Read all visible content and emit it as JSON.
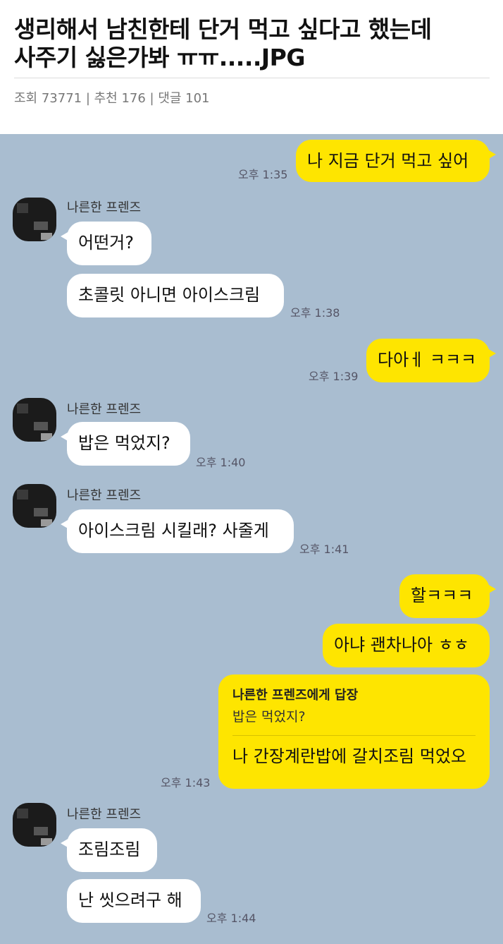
{
  "post": {
    "title_line1": "생리해서 남친한테 단거 먹고 싶다고 했는데",
    "title_line2": "사주기 싫은가봐 ㅠㅠ.....JPG",
    "meta": "조회 73771 | 추천 176 | 댓글 101"
  },
  "chat": {
    "sender_name": "나른한 프렌즈",
    "messages": [
      {
        "text": "나 지금 단거 먹고 싶어",
        "time": "오후 1:35"
      },
      {
        "text": "어떤거?"
      },
      {
        "text": "초콜릿 아니면 아이스크림",
        "time": "오후 1:38"
      },
      {
        "text": "다아ㅔ ㅋㅋㅋ",
        "time": "오후 1:39"
      },
      {
        "text": "밥은 먹었지?",
        "time": "오후 1:40"
      },
      {
        "text": "아이스크림 시킬래? 사줄게",
        "time": "오후 1:41"
      },
      {
        "text": "할ㅋㅋㅋ"
      },
      {
        "text": "아냐 괜차나아 ㅎㅎ"
      },
      {
        "reply_header": "나른한 프렌즈에게 답장",
        "reply_quote": "밥은 먹었지?",
        "text": "나 간장계란밥에 갈치조림 먹었오",
        "time": "오후 1:43"
      },
      {
        "text": "조림조림"
      },
      {
        "text": "난 씻으려구 해",
        "time": "오후 1:44"
      }
    ]
  },
  "colors": {
    "chat_background": "#a9bdd0",
    "my_bubble": "#fee500",
    "their_bubble": "#ffffff"
  }
}
